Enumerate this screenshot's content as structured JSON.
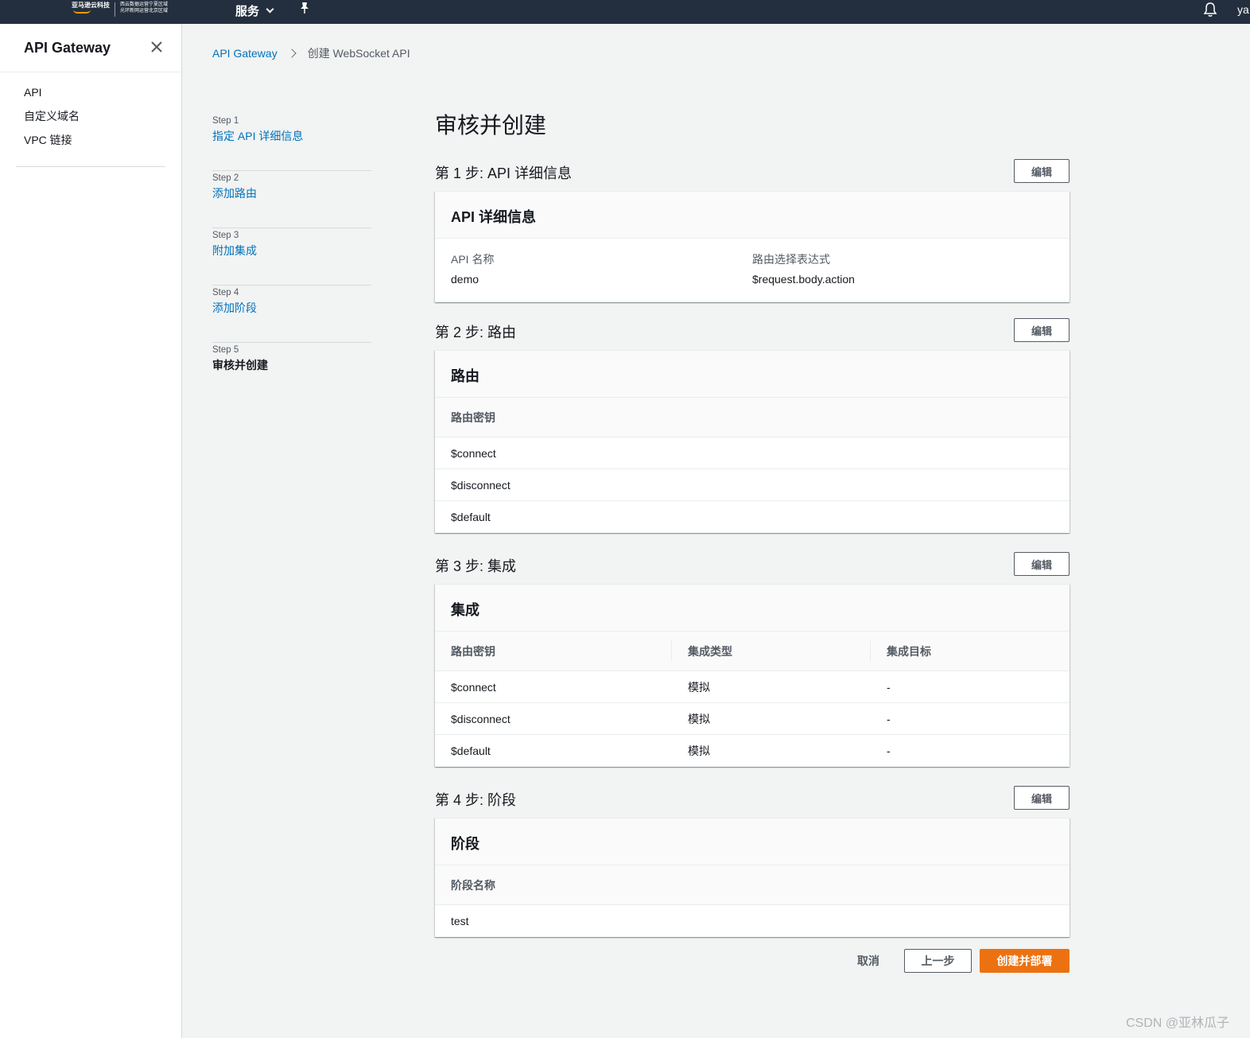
{
  "topbar": {
    "logo_main": "亚马逊云科技",
    "logo_sub_1": "西云数据运营宁夏区域",
    "logo_sub_2": "光环新网运营北京区域",
    "services_label": "服务",
    "user_short": "ya",
    "icons": [
      "pin-icon",
      "bell-icon",
      "chevron-down-icon"
    ]
  },
  "sidebar": {
    "title": "API Gateway",
    "items": [
      {
        "label": "API"
      },
      {
        "label": "自定义域名"
      },
      {
        "label": "VPC 链接"
      }
    ]
  },
  "breadcrumb": {
    "link": "API Gateway",
    "current": "创建 WebSocket API"
  },
  "steps": [
    {
      "num": "Step 1",
      "label": "指定 API 详细信息"
    },
    {
      "num": "Step 2",
      "label": "添加路由"
    },
    {
      "num": "Step 3",
      "label": "附加集成"
    },
    {
      "num": "Step 4",
      "label": "添加阶段"
    },
    {
      "num": "Step 5",
      "label": "审核并创建"
    }
  ],
  "main": {
    "title": "审核并创建",
    "edit_label": "编辑",
    "section1": {
      "title": "第 1 步: API 详细信息",
      "card_title": "API 详细信息",
      "api_name_key": "API 名称",
      "api_name_value": "demo",
      "route_expr_key": "路由选择表达式",
      "route_expr_value": "$request.body.action"
    },
    "section2": {
      "title": "第 2 步: 路由",
      "card_title": "路由",
      "column": "路由密钥",
      "rows": [
        "$connect",
        "$disconnect",
        "$default"
      ]
    },
    "section3": {
      "title": "第 3 步: 集成",
      "card_title": "集成",
      "columns": [
        "路由密钥",
        "集成类型",
        "集成目标"
      ],
      "rows": [
        [
          "$connect",
          "模拟",
          "-"
        ],
        [
          "$disconnect",
          "模拟",
          "-"
        ],
        [
          "$default",
          "模拟",
          "-"
        ]
      ]
    },
    "section4": {
      "title": "第 4 步: 阶段",
      "card_title": "阶段",
      "column": "阶段名称",
      "rows": [
        "test"
      ]
    }
  },
  "footer": {
    "cancel": "取消",
    "previous": "上一步",
    "create": "创建并部署"
  },
  "watermark": "CSDN @亚林瓜子",
  "colors": {
    "topbar": "#232f3e",
    "link": "#0073bb",
    "primary_button": "#ec7211"
  }
}
